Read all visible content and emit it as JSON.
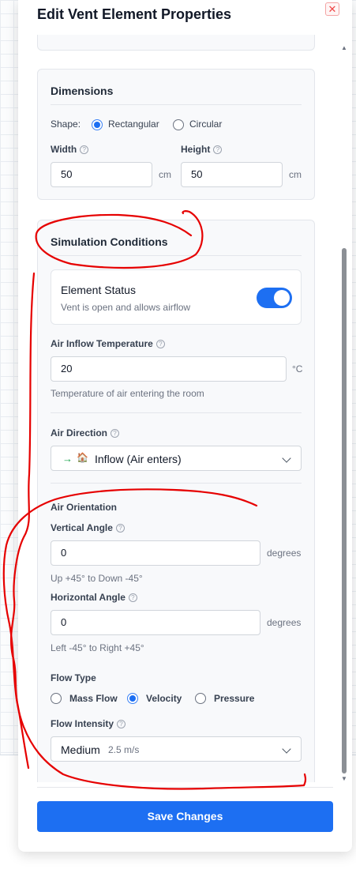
{
  "dialog": {
    "title": "Edit Vent Element Properties",
    "close_glyph": "✕",
    "save_label": "Save Changes"
  },
  "dimensions": {
    "title": "Dimensions",
    "shape_label": "Shape:",
    "shape_options": [
      "Rectangular",
      "Circular"
    ],
    "shape_selected": "Rectangular",
    "width_label": "Width",
    "width_value": "50",
    "width_unit": "cm",
    "height_label": "Height",
    "height_value": "50",
    "height_unit": "cm"
  },
  "simulation": {
    "title": "Simulation Conditions",
    "status": {
      "title": "Element Status",
      "description": "Vent is open and allows airflow",
      "enabled": true
    },
    "inflow_temp": {
      "label": "Air Inflow Temperature",
      "value": "20",
      "unit": "°C",
      "hint": "Temperature of air entering the room"
    },
    "direction": {
      "label": "Air Direction",
      "arrow": "→",
      "icon": "🏠",
      "value": "Inflow (Air enters)"
    },
    "orientation": {
      "title": "Air Orientation",
      "vertical_label": "Vertical Angle",
      "vertical_value": "0",
      "vertical_unit": "degrees",
      "vertical_hint": "Up +45° to Down -45°",
      "horizontal_label": "Horizontal Angle",
      "horizontal_value": "0",
      "horizontal_unit": "degrees",
      "horizontal_hint": "Left -45° to Right +45°"
    },
    "flow_type": {
      "label": "Flow Type",
      "options": [
        "Mass Flow",
        "Velocity",
        "Pressure"
      ],
      "selected": "Velocity"
    },
    "flow_intensity": {
      "label": "Flow Intensity",
      "value": "Medium",
      "detail": "2.5 m/s"
    }
  },
  "scrollbar": {
    "up_arrow": "▲",
    "down_arrow": "▼",
    "scroll_position": 0.28
  },
  "colors": {
    "accent": "#1d6ff2",
    "annotation": "#e60000",
    "close": "#ef4444"
  },
  "help_glyph": "?"
}
